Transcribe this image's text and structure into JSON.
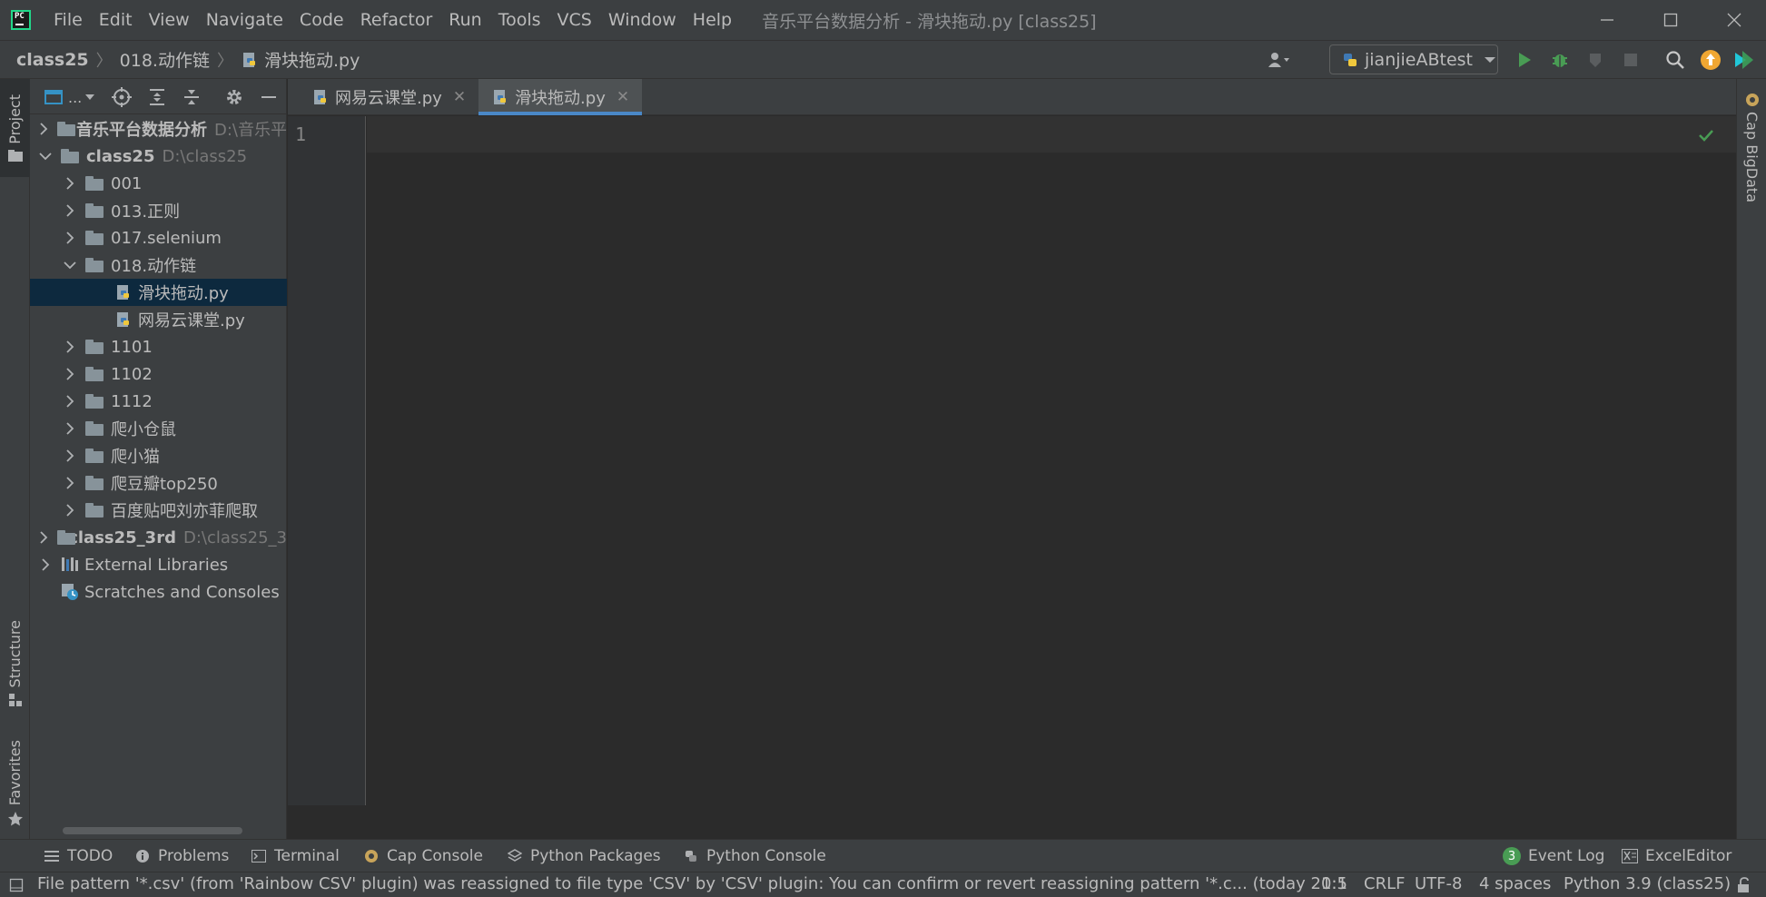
{
  "menu": [
    "File",
    "Edit",
    "View",
    "Navigate",
    "Code",
    "Refactor",
    "Run",
    "Tools",
    "VCS",
    "Window",
    "Help"
  ],
  "window_title": "音乐平台数据分析 - 滑块拖动.py [class25]",
  "breadcrumb": [
    "class25",
    "018.动作链",
    "滑块拖动.py"
  ],
  "run_config": "jianjieABtest",
  "left_strip": {
    "project": "Project",
    "structure": "Structure",
    "favorites": "Favorites"
  },
  "right_strip": {
    "cap_bigdata": "Cap BigData"
  },
  "panel": {
    "view_label": "..."
  },
  "tree": [
    {
      "label": "音乐平台数据分析",
      "path": "D:\\音乐平",
      "bold": true
    },
    {
      "label": "class25",
      "path": "D:\\class25",
      "bold": true
    },
    {
      "label": "001"
    },
    {
      "label": "013.正则"
    },
    {
      "label": "017.selenium"
    },
    {
      "label": "018.动作链"
    },
    {
      "label": "滑块拖动.py"
    },
    {
      "label": "网易云课堂.py"
    },
    {
      "label": "1101"
    },
    {
      "label": "1102"
    },
    {
      "label": "1112"
    },
    {
      "label": "爬小仓鼠"
    },
    {
      "label": "爬小猫"
    },
    {
      "label": "爬豆瓣top250"
    },
    {
      "label": "百度贴吧刘亦菲爬取"
    },
    {
      "label": "class25_3rd",
      "path": "D:\\class25_3",
      "bold": true
    },
    {
      "label": "External Libraries"
    },
    {
      "label": "Scratches and Consoles"
    }
  ],
  "tabs": [
    {
      "label": "网易云课堂.py",
      "active": false
    },
    {
      "label": "滑块拖动.py",
      "active": true
    }
  ],
  "editor": {
    "line_numbers": [
      "1"
    ]
  },
  "tool_windows": {
    "todo": "TODO",
    "problems": "Problems",
    "terminal": "Terminal",
    "cap_console": "Cap Console",
    "python_packages": "Python Packages",
    "python_console": "Python Console",
    "event_log_count": "3",
    "event_log": "Event Log",
    "excel_editor": "ExcelEditor"
  },
  "status": {
    "message": "File pattern '*.csv' (from 'Rainbow CSV' plugin) was reassigned to file type 'CSV' by 'CSV' plugin: You can confirm or revert reassigning pattern '*.c... (today 20:5",
    "position": "1:1",
    "line_sep": "CRLF",
    "encoding": "UTF-8",
    "indent": "4 spaces",
    "interpreter": "Python 3.9 (class25)"
  },
  "colors": {
    "accent_tab": "#4a88c7",
    "selection": "#0d293e",
    "run_green": "#499c54",
    "update_orange": "#f0a732"
  }
}
